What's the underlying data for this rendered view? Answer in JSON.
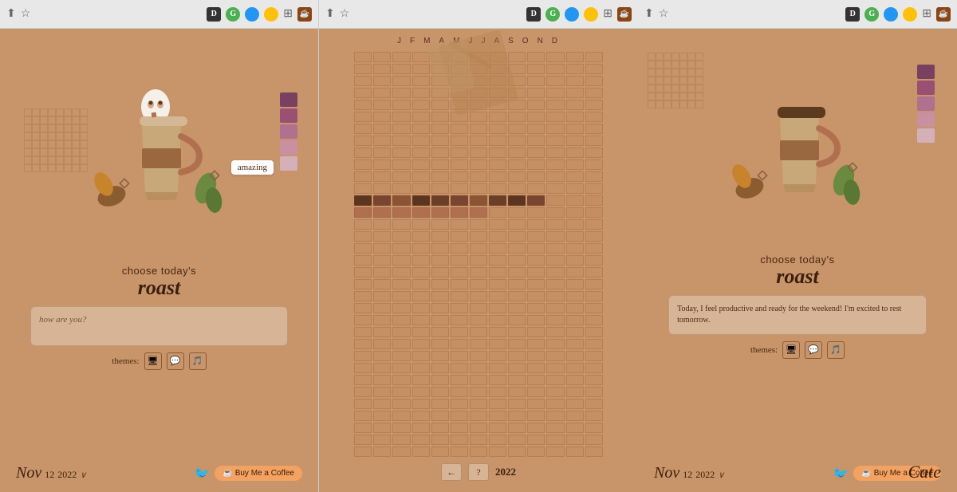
{
  "panels": [
    {
      "id": "left",
      "toolbar": {
        "icons": [
          "share",
          "star",
          "d",
          "g",
          "browser-blue",
          "browser-yellow",
          "grid",
          "coffee"
        ]
      },
      "content": {
        "tooltip": "amazing",
        "swatches": [
          "#7a4060",
          "#9a5070",
          "#b07090",
          "#c890a0",
          "#d4b0b8"
        ],
        "barcode_label": "|||  ||| |||",
        "choose_text": "choose today's",
        "roast_text": "roast",
        "mood_placeholder": "how are you?",
        "themes_label": "themes:",
        "theme_icons": [
          "monitor",
          "chat",
          "music"
        ],
        "date_month": "Nov",
        "date_day": "12",
        "date_year": "2022",
        "buy_coffee_label": "Buy Me a Coffee"
      }
    },
    {
      "id": "middle",
      "toolbar": {
        "icons": [
          "share",
          "star",
          "d",
          "g",
          "browser-blue",
          "browser-yellow",
          "grid",
          "coffee"
        ]
      },
      "content": {
        "months": [
          "J",
          "F",
          "M",
          "A",
          "M",
          "J",
          "J",
          "A",
          "S",
          "O",
          "N",
          "D"
        ],
        "year": "2022",
        "nav_prev": "←",
        "nav_help": "?",
        "highlight_row": 13
      }
    },
    {
      "id": "right",
      "toolbar": {
        "icons": [
          "share",
          "star",
          "d",
          "g",
          "browser-blue",
          "browser-yellow",
          "grid",
          "coffee"
        ]
      },
      "content": {
        "swatches": [
          "#7a4060",
          "#9a5070",
          "#b07090",
          "#c890a0",
          "#d4b0b8"
        ],
        "barcode_label": "|||  ||| |||",
        "choose_text": "choose today's",
        "roast_text": "roast",
        "journal_text": "Today, I feel productive and ready for the weekend! I'm excited to rest tomorrow.",
        "themes_label": "themes:",
        "theme_icons": [
          "monitor",
          "chat",
          "music"
        ],
        "date_month": "Nov",
        "date_day": "12",
        "date_year": "2022",
        "buy_coffee_label": "Buy Me a Coffee",
        "cate_label": "Cate"
      }
    }
  ]
}
